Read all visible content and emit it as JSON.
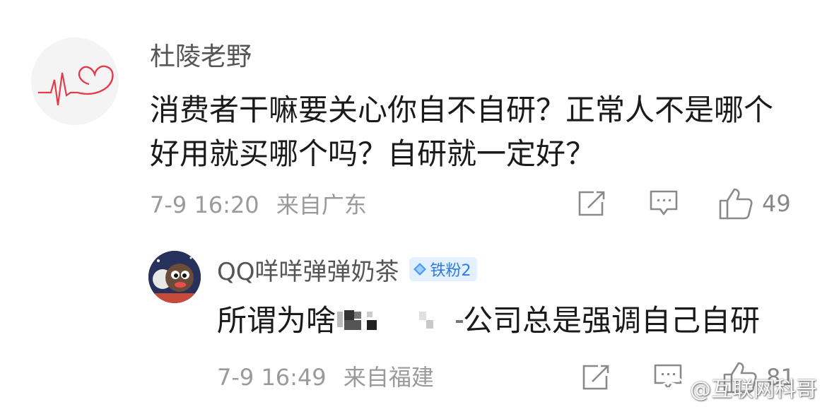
{
  "comment": {
    "username": "杜陵老野",
    "text": "消费者干嘛要关心你自不自研？正常人不是哪个好用就买哪个吗？自研就一定好？",
    "time": "7-9 16:20",
    "location": "来自广东",
    "like_count": "49",
    "icons": {
      "share": "share-icon",
      "reply": "comment-icon",
      "like": "thumbs-up-icon"
    }
  },
  "reply": {
    "username": "QQ咩咩弹弹奶茶",
    "badge_label": "铁粉2",
    "text_before": "所谓为啥",
    "text_after": "公司总是强调自己自研",
    "time": "7-9 16:49",
    "location": "来自福建",
    "like_count": "81"
  },
  "watermark": {
    "text": "@互联网科哥"
  },
  "colors": {
    "meta": "#9a9a9a",
    "badge_bg": "#e3f0ff",
    "badge_text": "#2f7ae5",
    "heart": "#e23b4b"
  }
}
